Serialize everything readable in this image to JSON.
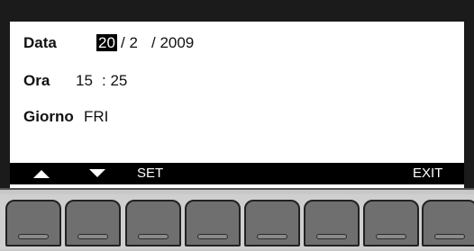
{
  "fields": {
    "date": {
      "label": "Data",
      "day": "20",
      "month_part": "/ 2",
      "year_part": "/ 2009"
    },
    "time": {
      "label": "Ora",
      "hour": "15",
      "minute_part": ": 25"
    },
    "weekday": {
      "label": "Giorno",
      "value": "FRI"
    }
  },
  "softkeys": {
    "up_icon": "triangle-up",
    "down_icon": "triangle-down",
    "set_label": "SET",
    "exit_label": "EXIT"
  },
  "hardware": {
    "button_count": 8
  }
}
